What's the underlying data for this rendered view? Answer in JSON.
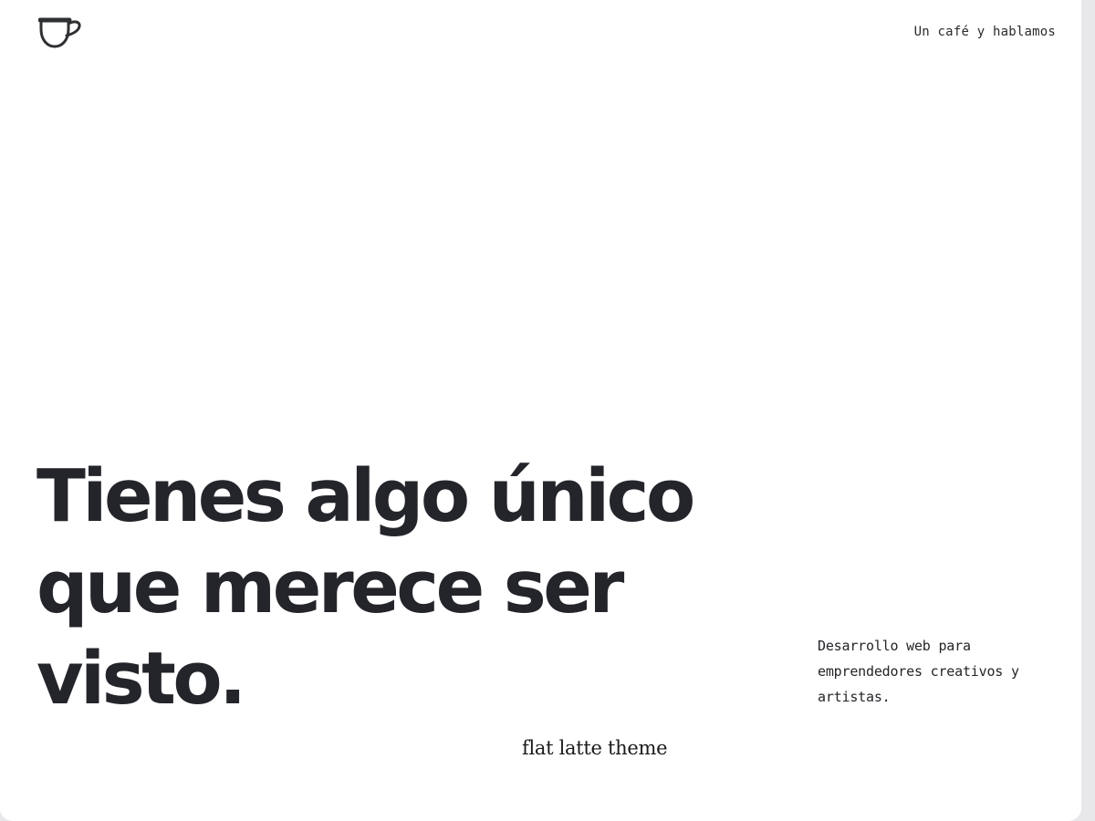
{
  "header": {
    "logo_icon": "coffee-cup-icon",
    "nav_link_label": "Un café y hablamos"
  },
  "hero": {
    "title_lines": [
      "Tienes algo único",
      "que merece ser",
      "visto."
    ],
    "tagline": "Desarrollo web para emprendedores creativos y artistas."
  },
  "footer": {
    "theme_label": "flat latte theme"
  },
  "colors": {
    "background": "#ffffff",
    "text": "#24252a",
    "frame": "#e8e8ea"
  }
}
